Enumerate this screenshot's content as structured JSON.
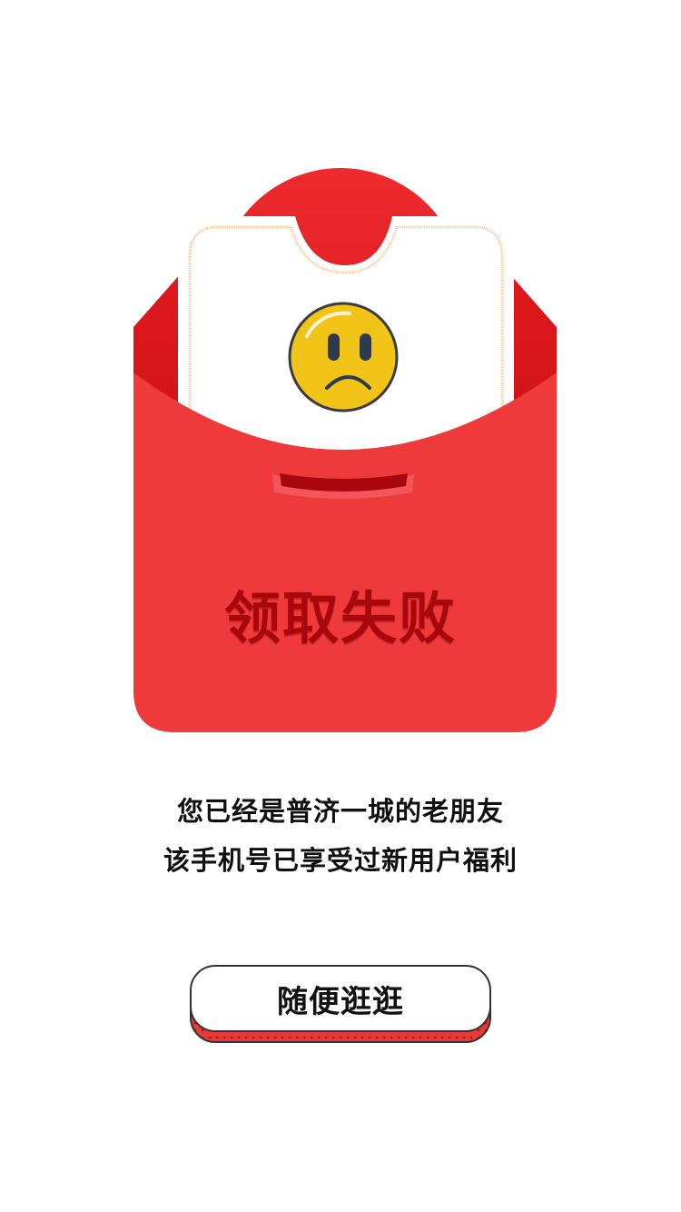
{
  "envelope": {
    "status_text": "领取失败",
    "icon": "sad-face-icon",
    "colors": {
      "envelope_red": "#ef3a3c",
      "envelope_dark_red": "#d81e22",
      "status_text": "#a8080c",
      "emoji_yellow": "#f2c417",
      "card_border": "#f0c89a"
    }
  },
  "message": {
    "line1": "您已经是普济一城的老朋友",
    "line2": "该手机号已享受过新用户福利"
  },
  "action": {
    "button_label": "随便逛逛"
  }
}
